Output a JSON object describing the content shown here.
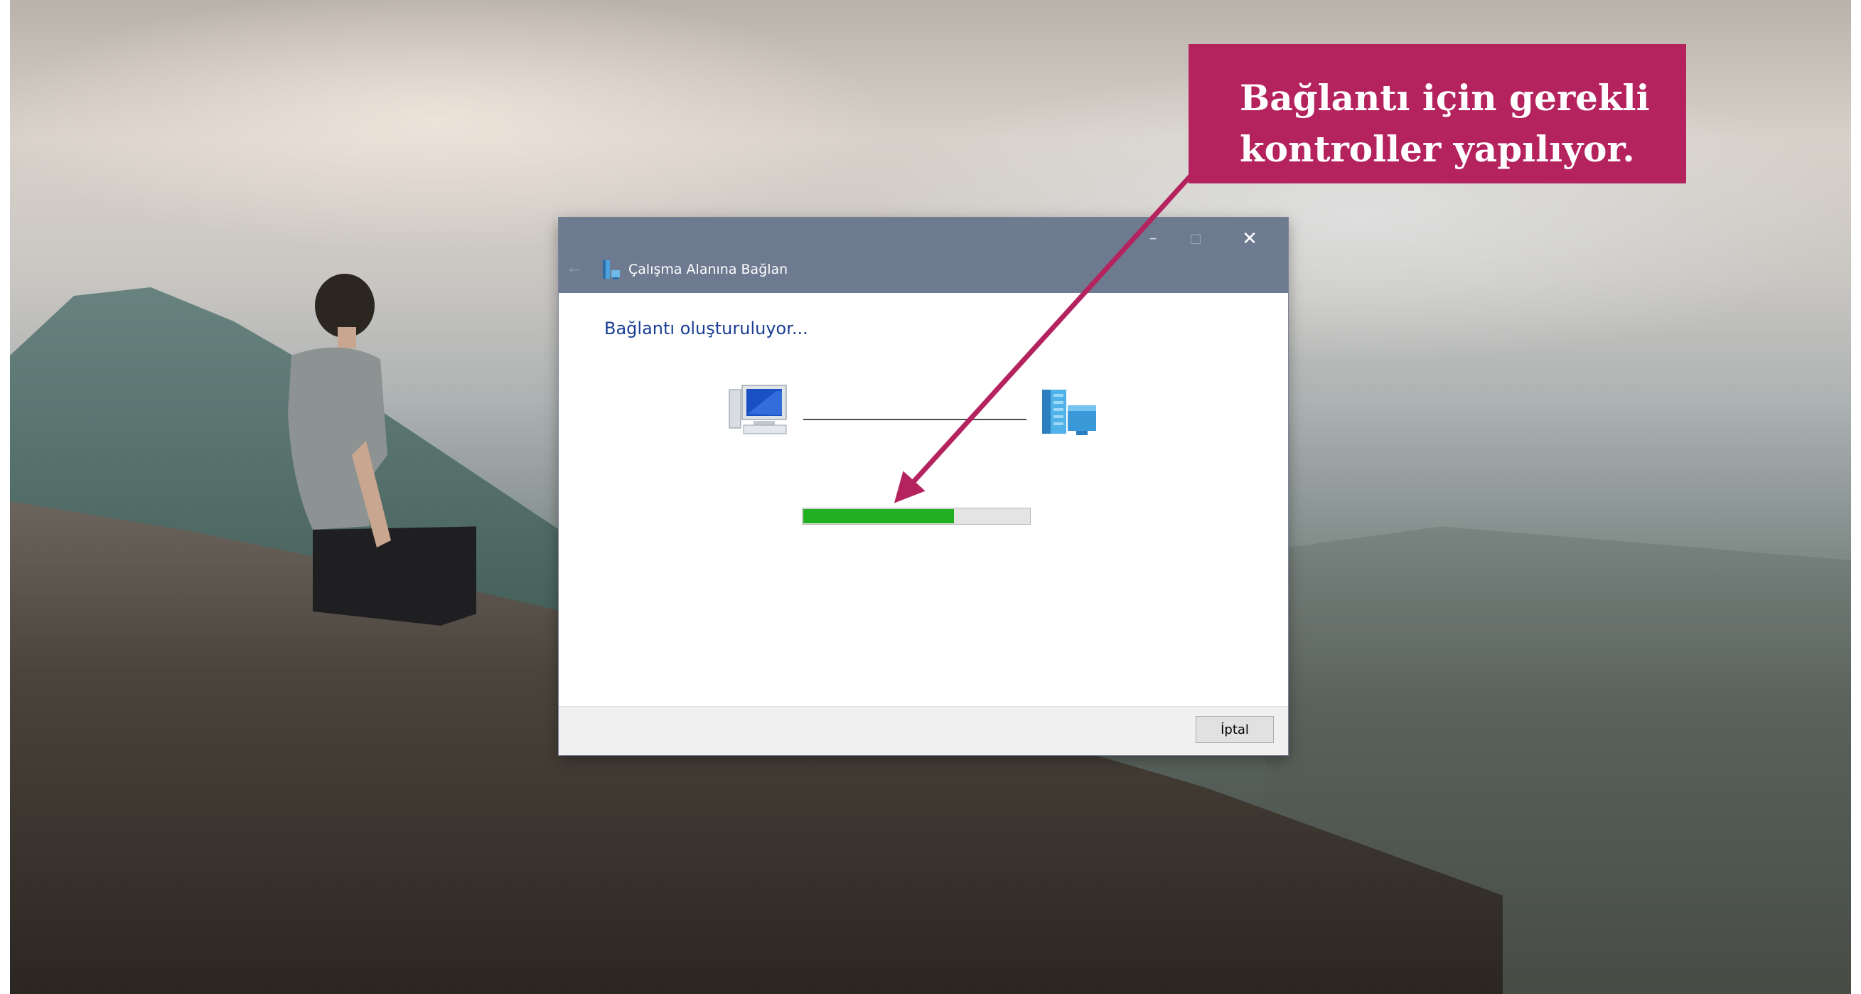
{
  "window": {
    "title": "Çalışma Alanına Bağlan",
    "buttons": {
      "minimize": "–",
      "maximize": "□",
      "close": "✕"
    },
    "back": "←"
  },
  "content": {
    "status": "Bağlantı oluşturuluyor...",
    "progress_fraction": 0.67,
    "icons": {
      "local": "computer-icon",
      "remote": "server-icon",
      "app": "workplace-connection-icon"
    }
  },
  "footer": {
    "cancel_label": "İptal"
  },
  "callout": {
    "text": "Bağlantı için gerekli kontroller yapılıyor."
  },
  "colors": {
    "titlebar": "#6d7a90",
    "status_text": "#1a3e93",
    "progress": "#22b023",
    "callout": "#b5235f"
  }
}
